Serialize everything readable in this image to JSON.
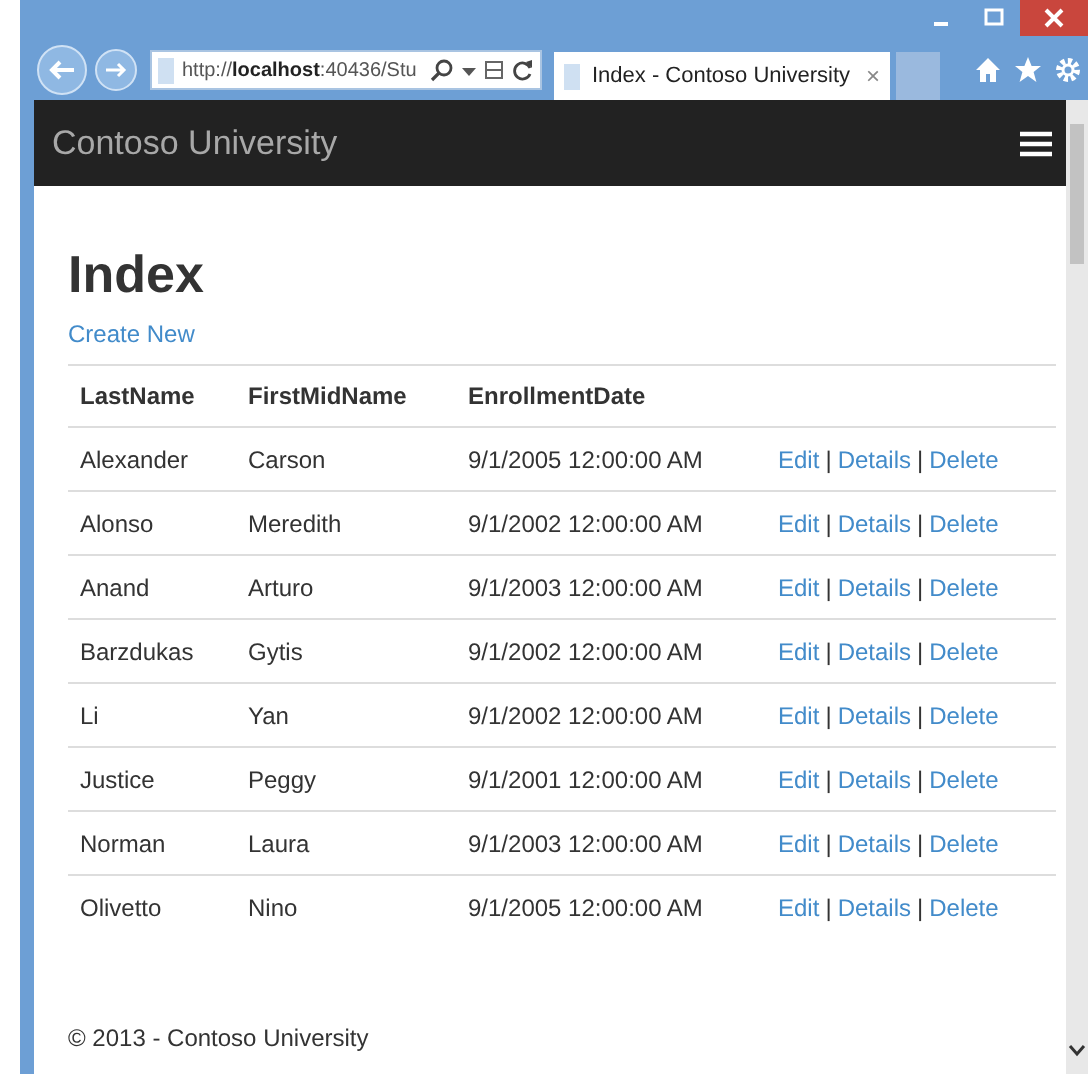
{
  "browser": {
    "address": "http://**localhost**:40436/Stu",
    "tab": {
      "title": "Index - Contoso University",
      "close": "×"
    }
  },
  "navbar": {
    "brand": "Contoso University"
  },
  "page": {
    "title": "Index",
    "create_link": "Create New"
  },
  "table": {
    "columns": [
      "LastName",
      "FirstMidName",
      "EnrollmentDate"
    ],
    "rows": [
      {
        "cells": [
          "Alexander",
          "Carson",
          "9/1/2005 12:00:00 AM"
        ],
        "actions": [
          "Edit",
          "Details",
          "Delete"
        ]
      },
      {
        "cells": [
          "Alonso",
          "Meredith",
          "9/1/2002 12:00:00 AM"
        ],
        "actions": [
          "Edit",
          "Details",
          "Delete"
        ]
      },
      {
        "cells": [
          "Anand",
          "Arturo",
          "9/1/2003 12:00:00 AM"
        ],
        "actions": [
          "Edit",
          "Details",
          "Delete"
        ]
      },
      {
        "cells": [
          "Barzdukas",
          "Gytis",
          "9/1/2002 12:00:00 AM"
        ],
        "actions": [
          "Edit",
          "Details",
          "Delete"
        ]
      },
      {
        "cells": [
          "Li",
          "Yan",
          "9/1/2002 12:00:00 AM"
        ],
        "actions": [
          "Edit",
          "Details",
          "Delete"
        ]
      },
      {
        "cells": [
          "Justice",
          "Peggy",
          "9/1/2001 12:00:00 AM"
        ],
        "actions": [
          "Edit",
          "Details",
          "Delete"
        ]
      },
      {
        "cells": [
          "Norman",
          "Laura",
          "9/1/2003 12:00:00 AM"
        ],
        "actions": [
          "Edit",
          "Details",
          "Delete"
        ]
      },
      {
        "cells": [
          "Olivetto",
          "Nino",
          "9/1/2005 12:00:00 AM"
        ],
        "actions": [
          "Edit",
          "Details",
          "Delete"
        ]
      }
    ],
    "separator": "|"
  },
  "footer": "© 2013 - Contoso University"
}
